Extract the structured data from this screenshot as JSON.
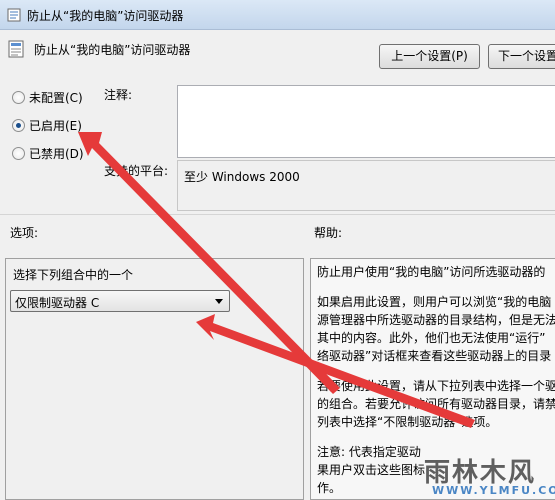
{
  "window": {
    "title": "防止从“我的电脑”访问驱动器"
  },
  "header": {
    "title": "防止从“我的电脑”访问驱动器",
    "prev_button": "上一个设置(P)",
    "next_button": "下一个设置"
  },
  "state": {
    "options": [
      {
        "label": "未配置(C)",
        "checked": false
      },
      {
        "label": "已启用(E)",
        "checked": true
      },
      {
        "label": "已禁用(D)",
        "checked": false
      }
    ],
    "comment_label": "注释:",
    "supported_label": "支持的平台:",
    "supported_value": "至少 Windows 2000"
  },
  "options_section": {
    "label": "选项:",
    "select_label": "选择下列组合中的一个",
    "dropdown_value": "仅限制驱动器 C"
  },
  "help_section": {
    "label": "帮助:",
    "paragraphs": [
      [
        "防止用户使用“我的电脑”访问所选驱动器的"
      ],
      [
        "如果启用此设置，则用户可以浏览“我的电脑",
        "源管理器中所选驱动器的目录结构，但是无法",
        "其中的内容。此外，他们也无法使用“运行”",
        "络驱动器”对话框来查看这些驱动器上的目录"
      ],
      [
        "若要使用此设置，请从下拉列表中选择一个驱",
        "的组合。若要允许访问所有驱动器目录，请禁",
        "列表中选择“不限制驱动器”选项。"
      ],
      [
        "注意: 代表指定驱动",
        "果用户双击这些图标",
        "作。"
      ]
    ]
  },
  "watermark": {
    "main": "雨林木风",
    "sub": "WWW.YLMFU.COM"
  },
  "colors": {
    "annotation_arrow": "#e53a3a",
    "title_bar": "#c3d6ec",
    "selected_radio": "#1b4f8c"
  },
  "icons": {
    "window": "policy-icon",
    "header": "policy-document-icon"
  }
}
